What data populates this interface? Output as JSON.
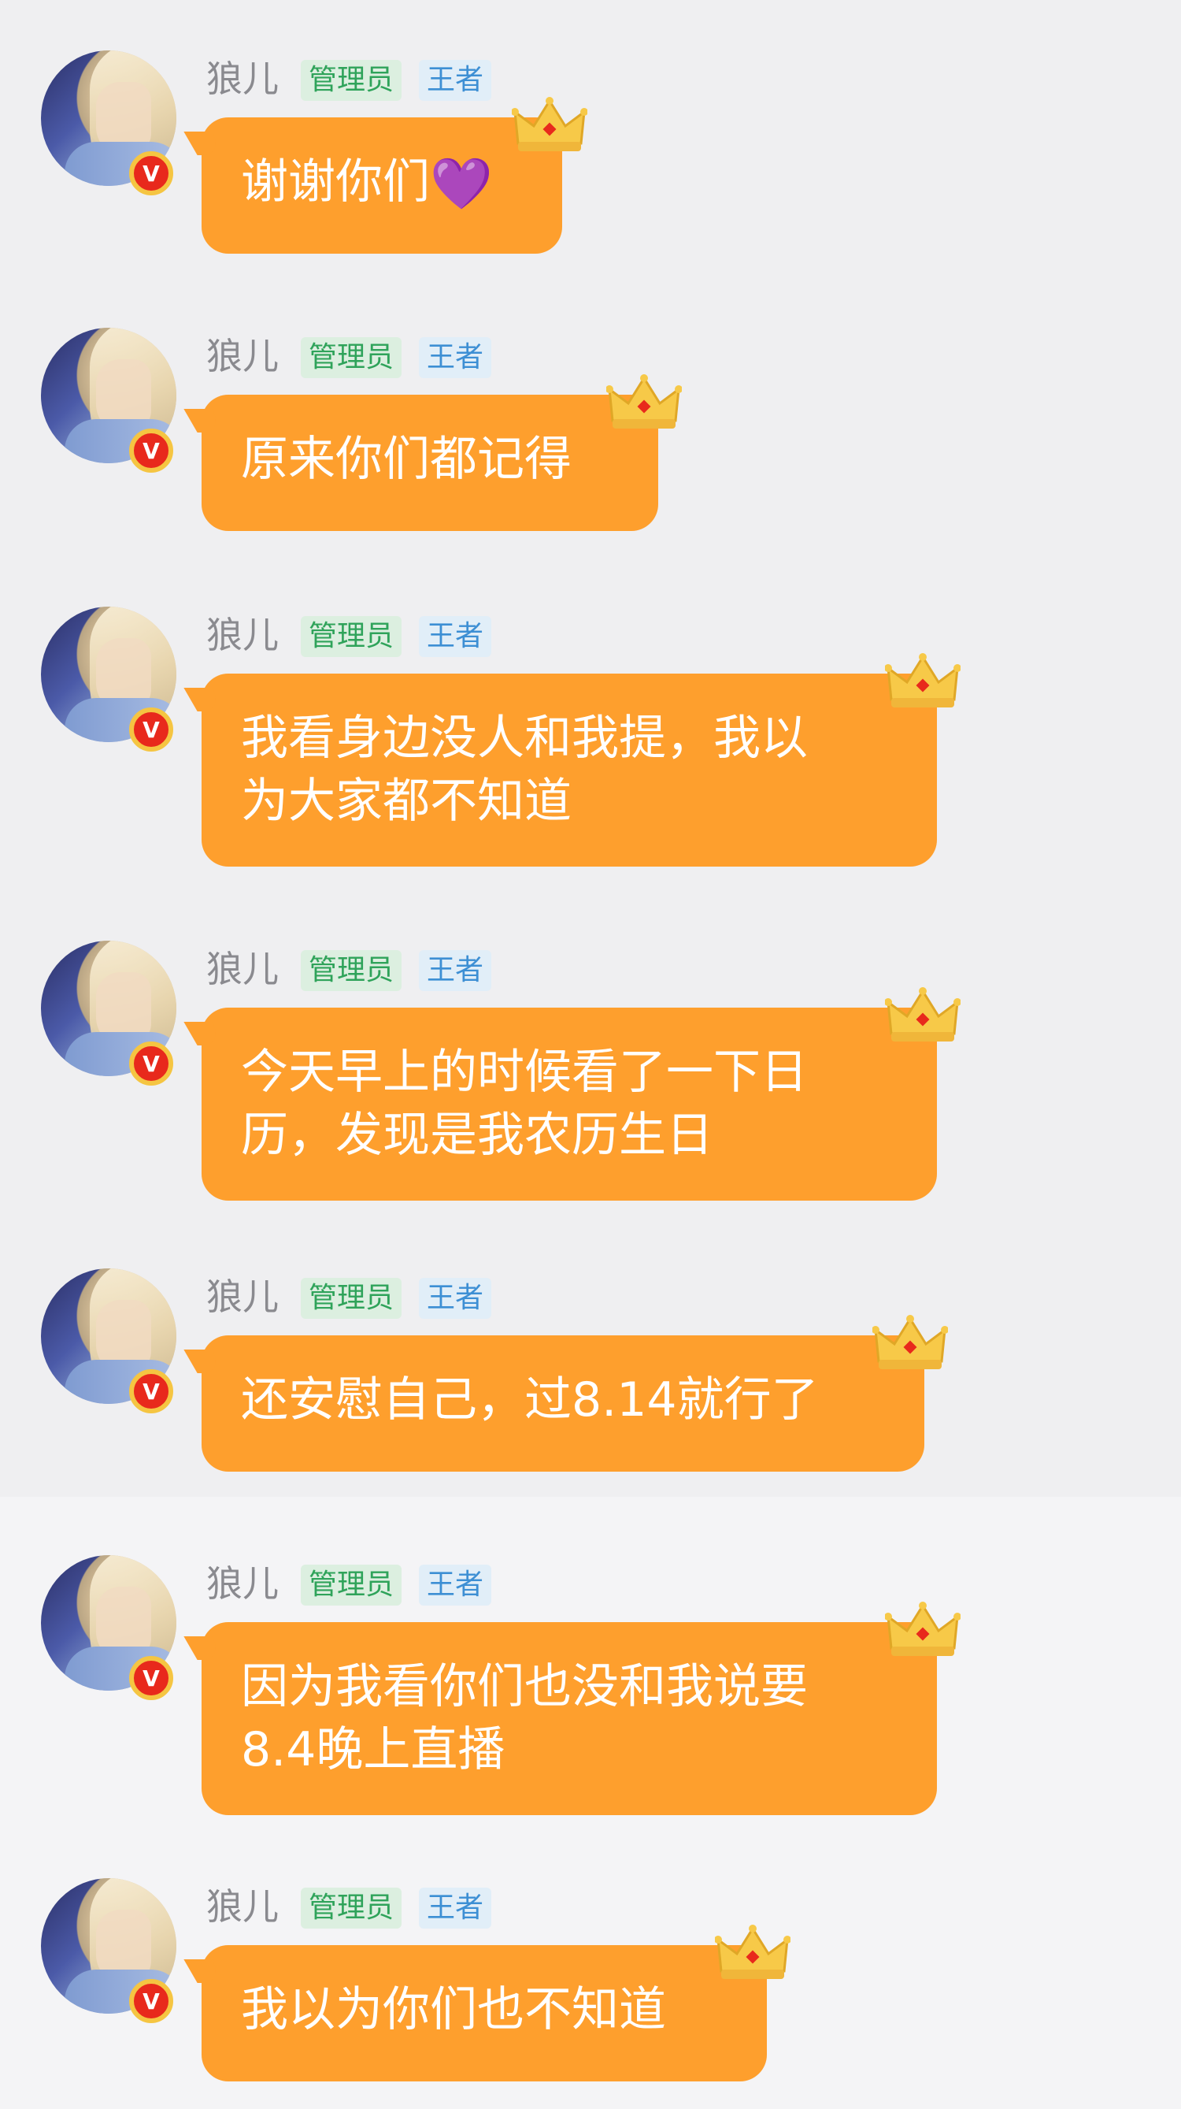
{
  "colors": {
    "background": "#efeff1",
    "bubble": "#fe9f2d",
    "admin_tag_bg": "#dcefe0",
    "admin_tag_text": "#2fa35a",
    "king_tag_bg": "#e1eef8",
    "king_tag_text": "#3d8fd4",
    "name_text": "#8a8a8f"
  },
  "sender": {
    "name": "狼儿",
    "role_tag": "管理员",
    "level_tag": "王者",
    "verified_badge": "V"
  },
  "messages": [
    {
      "text": "谢谢你们",
      "emoji": "💜"
    },
    {
      "text": "原来你们都记得"
    },
    {
      "text": "我看身边没人和我提，我以\n为大家都不知道"
    },
    {
      "text": "今天早上的时候看了一下日\n历，发现是我农历生日"
    },
    {
      "text": "还安慰自己，过8.14就行了"
    },
    {
      "text": "因为我看你们也没和我说要\n8.4晚上直播"
    },
    {
      "text": "我以为你们也不知道"
    }
  ]
}
